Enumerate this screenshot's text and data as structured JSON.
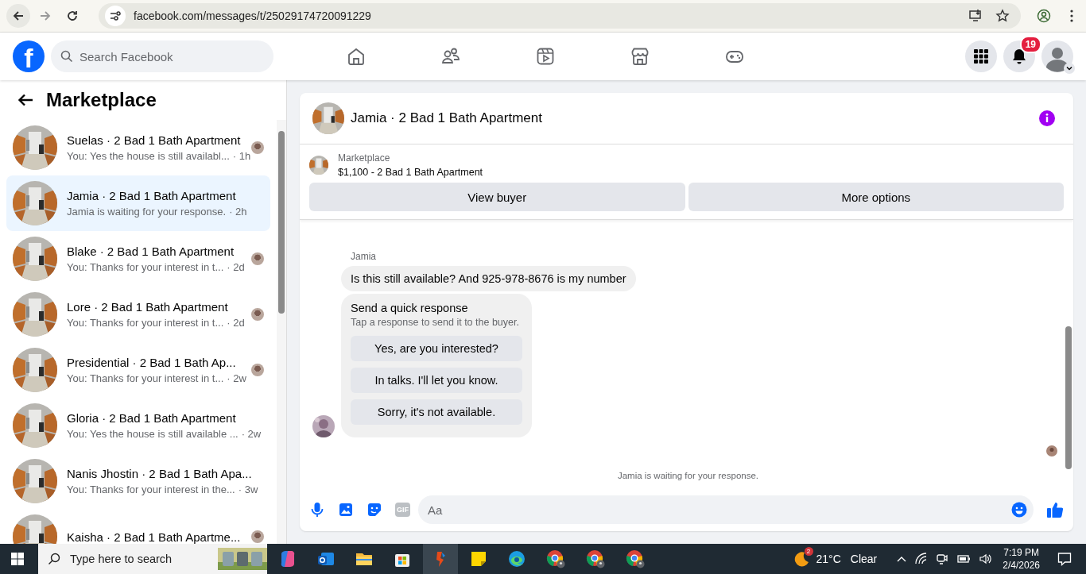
{
  "browser": {
    "url": "facebook.com/messages/t/25029174720091229"
  },
  "header": {
    "logo": "f",
    "search_placeholder": "Search Facebook",
    "notification_count": "19"
  },
  "sidebar": {
    "title": "Marketplace",
    "conversations": [
      {
        "title": "Suelas · 2 Bad 1 Bath Apartment",
        "preview": "You: Yes the house is still availabl...",
        "time": "· 1h",
        "selected": false,
        "seen": true
      },
      {
        "title": "Jamia · 2 Bad 1 Bath Apartment",
        "preview": "Jamia is waiting for your response.",
        "time": "· 2h",
        "selected": true,
        "seen": false
      },
      {
        "title": "Blake · 2 Bad 1 Bath Apartment",
        "preview": "You: Thanks for your interest in t...",
        "time": "· 2d",
        "selected": false,
        "seen": true
      },
      {
        "title": "Lore · 2 Bad 1 Bath Apartment",
        "preview": "You: Thanks for your interest in t...",
        "time": "· 2d",
        "selected": false,
        "seen": true
      },
      {
        "title": "Presidential · 2 Bad 1 Bath Ap...",
        "preview": "You: Thanks for your interest in t...",
        "time": "· 2w",
        "selected": false,
        "seen": true
      },
      {
        "title": "Gloria · 2 Bad 1 Bath Apartment",
        "preview": "You: Yes the house is still available ...",
        "time": "· 2w",
        "selected": false,
        "seen": false
      },
      {
        "title": "Nanis Jhostin · 2 Bad 1 Bath Apa...",
        "preview": "You: Thanks for your interest in the...",
        "time": "· 3w",
        "selected": false,
        "seen": false
      },
      {
        "title": "Kaisha · 2 Bad 1 Bath Apartme...",
        "selected": false,
        "seen": true
      }
    ]
  },
  "chat": {
    "title": "Jamia · 2 Bad 1 Bath Apartment",
    "listing": {
      "label": "Marketplace",
      "item": "$1,100 - 2 Bad 1 Bath Apartment"
    },
    "buttons": [
      "View buyer",
      "More options"
    ],
    "sender": "Jamia",
    "message": "Is this still available? And 925-978-8676 is my number",
    "quick_response": {
      "title": "Send a quick response",
      "subtitle": "Tap a response to send it to the buyer.",
      "options": [
        "Yes, are you interested?",
        "In talks. I'll let you know.",
        "Sorry, it's not available."
      ]
    },
    "status": "Jamia is waiting for your response.",
    "composer": {
      "placeholder": "Aa",
      "gif_label": "GIF"
    }
  },
  "taskbar": {
    "search_placeholder": "Type here to search",
    "weather_badge": "2",
    "temperature": "21°C",
    "condition": "Clear",
    "time": "7:19 PM",
    "date": "2/4/2026"
  }
}
